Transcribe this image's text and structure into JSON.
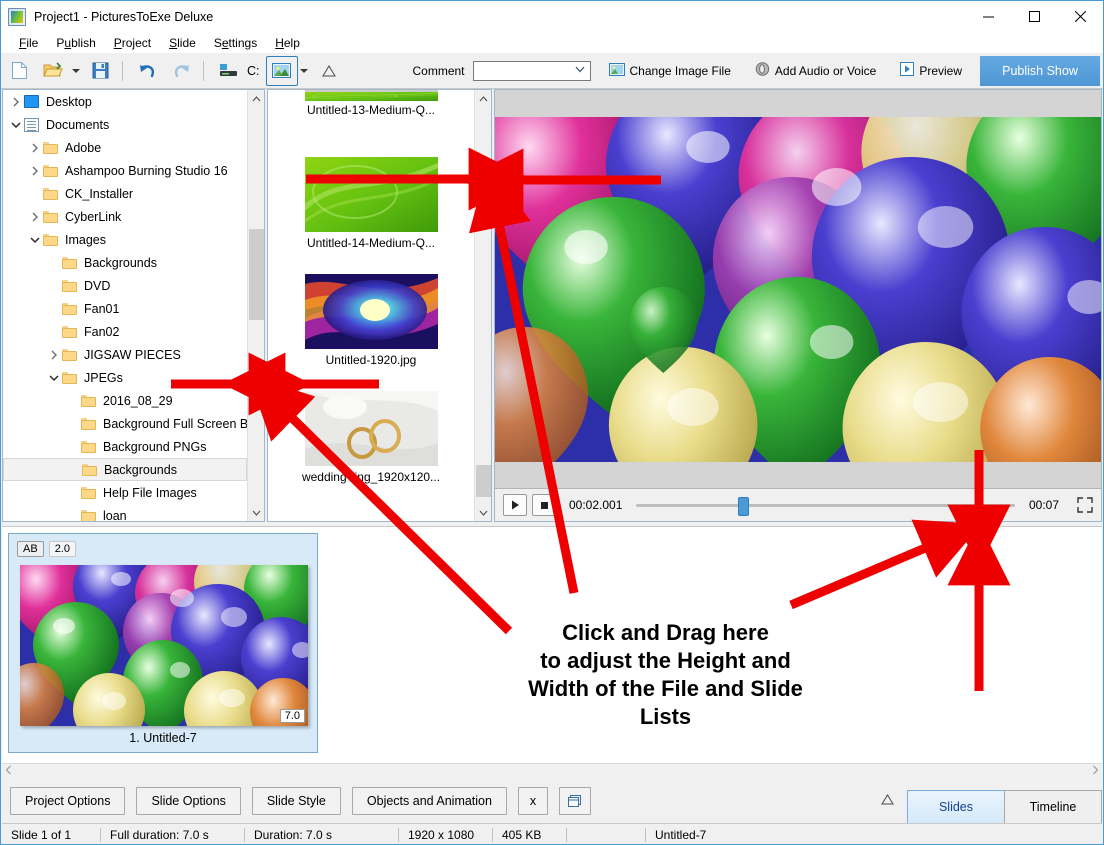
{
  "window": {
    "title": "Project1 - PicturesToExe Deluxe",
    "app_icon": "picturestoexe-icon",
    "minimize": "minimize-icon",
    "maximize": "maximize-icon",
    "close": "close-icon"
  },
  "menu": {
    "items": [
      {
        "label": "File",
        "accel": "F"
      },
      {
        "label": "Publish",
        "accel": "u"
      },
      {
        "label": "Project",
        "accel": "P"
      },
      {
        "label": "Slide",
        "accel": "S"
      },
      {
        "label": "Settings",
        "accel": "e"
      },
      {
        "label": "Help",
        "accel": "H"
      }
    ]
  },
  "toolbar": {
    "new_icon": "new-document-icon",
    "open_icon": "open-folder-icon",
    "open_dropdown_icon": "chevron-down-icon",
    "save_icon": "save-disk-icon",
    "undo_icon": "undo-arrow-icon",
    "redo_icon": "redo-arrow-icon",
    "burn_icon": "burn-disc-icon",
    "drive_label": "C:",
    "image_icon": "image-settings-icon",
    "image_dropdown_icon": "chevron-down-icon",
    "warning_icon": "triangle-icon",
    "comment_label": "Comment",
    "comment_value": "",
    "comment_placeholder": "",
    "comment_chevron": "chevron-down-icon",
    "change_image_label": "Change Image File",
    "change_image_icon": "image-file-icon",
    "add_audio_label": "Add Audio or Voice",
    "add_audio_icon": "speaker-icon",
    "preview_label": "Preview",
    "preview_icon": "play-box-icon",
    "publish_label": "Publish Show",
    "publish_color": "#4e97d6"
  },
  "tree": {
    "items": [
      {
        "label": "Desktop",
        "indent": 1,
        "expander": "collapsed",
        "icon": "desktop-icon",
        "selected": false
      },
      {
        "label": "Documents",
        "indent": 1,
        "expander": "expanded",
        "icon": "documents-icon",
        "selected": false
      },
      {
        "label": "Adobe",
        "indent": 2,
        "expander": "collapsed",
        "icon": "folder-icon",
        "selected": false
      },
      {
        "label": "Ashampoo Burning Studio 16",
        "indent": 2,
        "expander": "collapsed",
        "icon": "folder-icon",
        "selected": false
      },
      {
        "label": "CK_Installer",
        "indent": 2,
        "expander": "none",
        "icon": "folder-icon",
        "selected": false
      },
      {
        "label": "CyberLink",
        "indent": 2,
        "expander": "collapsed",
        "icon": "folder-icon",
        "selected": false
      },
      {
        "label": "Images",
        "indent": 2,
        "expander": "expanded",
        "icon": "folder-icon",
        "selected": false
      },
      {
        "label": "Backgrounds",
        "indent": 3,
        "expander": "none",
        "icon": "folder-icon",
        "selected": false
      },
      {
        "label": "DVD",
        "indent": 3,
        "expander": "none",
        "icon": "folder-icon",
        "selected": false
      },
      {
        "label": "Fan01",
        "indent": 3,
        "expander": "none",
        "icon": "folder-icon",
        "selected": false
      },
      {
        "label": "Fan02",
        "indent": 3,
        "expander": "none",
        "icon": "folder-icon",
        "selected": false
      },
      {
        "label": "JIGSAW PIECES",
        "indent": 3,
        "expander": "collapsed",
        "icon": "folder-icon",
        "selected": false
      },
      {
        "label": "JPEGs",
        "indent": 3,
        "expander": "expanded",
        "icon": "folder-icon",
        "selected": false
      },
      {
        "label": "2016_08_29",
        "indent": 4,
        "expander": "none",
        "icon": "folder-icon",
        "selected": false
      },
      {
        "label": "Background Full Screen B...",
        "indent": 4,
        "expander": "none",
        "icon": "folder-icon",
        "selected": false
      },
      {
        "label": "Background PNGs",
        "indent": 4,
        "expander": "none",
        "icon": "folder-icon",
        "selected": false
      },
      {
        "label": "Backgrounds",
        "indent": 4,
        "expander": "none",
        "icon": "folder-icon",
        "selected": true
      },
      {
        "label": "Help File Images",
        "indent": 4,
        "expander": "none",
        "icon": "folder-icon",
        "selected": false
      },
      {
        "label": "loan",
        "indent": 4,
        "expander": "none",
        "icon": "folder-icon",
        "selected": false
      }
    ],
    "scroll_up_icon": "chevron-up-icon",
    "scroll_down_icon": "chevron-down-icon"
  },
  "file_list": {
    "items": [
      {
        "name": "Untitled-13-Medium-Q...",
        "thumb": "green-abstract",
        "clipped_top": true
      },
      {
        "name": "Untitled-14-Medium-Q...",
        "thumb": "green-abstract",
        "clipped_top": false
      },
      {
        "name": "Untitled-1920.jpg",
        "thumb": "colorful-rays",
        "clipped_top": false
      },
      {
        "name": "wedding-ring_1920x120...",
        "thumb": "wedding-rings",
        "clipped_top": false
      }
    ],
    "scroll_up_icon": "chevron-up-icon",
    "scroll_down_icon": "chevron-down-icon"
  },
  "preview": {
    "image_name": "balloons-image",
    "play_icon": "play-icon",
    "stop_icon": "stop-icon",
    "current_time": "00:02.001",
    "total_time": "00:07",
    "progress_percent": 28,
    "fullscreen_icon": "fullscreen-icon"
  },
  "slide_strip": {
    "slides": [
      {
        "badge_ab": "AB",
        "badge_time": "2.0",
        "duration": "7.0",
        "caption": "1. Untitled-7",
        "thumb": "balloons-image"
      }
    ],
    "scroll_left_icon": "chevron-left-icon",
    "scroll_right_icon": "chevron-right-icon"
  },
  "bottom_toolbar": {
    "buttons": [
      {
        "label": "Project Options"
      },
      {
        "label": "Slide Options"
      },
      {
        "label": "Slide Style"
      },
      {
        "label": "Objects and Animation"
      },
      {
        "label": "x"
      }
    ],
    "extra_icon": "duplicate-window-icon",
    "triangle_icon": "triangle-icon",
    "tabs": [
      {
        "label": "Slides",
        "active": true
      },
      {
        "label": "Timeline",
        "active": false
      }
    ]
  },
  "status_bar": {
    "cells": [
      "Slide 1 of 1",
      "Full duration: 7.0 s",
      "Duration: 7.0 s",
      "1920 x 1080",
      "405 KB",
      "",
      "Untitled-7"
    ]
  },
  "annotation": {
    "color": "#ee0000",
    "lines": [
      "Click and Drag here",
      "to adjust the Height and",
      "Width of the File and Slide",
      "Lists"
    ]
  }
}
